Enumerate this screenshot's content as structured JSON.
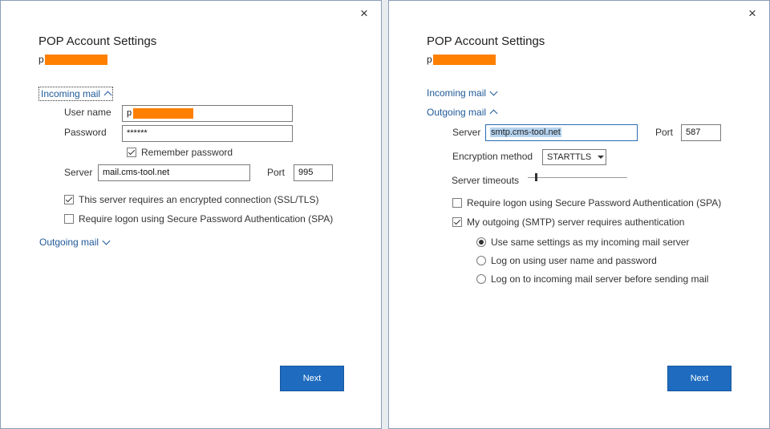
{
  "left": {
    "close_icon": "×",
    "title": "POP Account Settings",
    "account_prefix": "p",
    "incoming": {
      "label": "Incoming mail",
      "username_label": "User name",
      "username_prefix": "p",
      "password_label": "Password",
      "password_value": "******",
      "remember_label": "Remember password",
      "remember_checked": true,
      "server_label": "Server",
      "server_value": "mail.cms-tool.net",
      "port_label": "Port",
      "port_value": "995",
      "ssl_label": "This server requires an encrypted connection (SSL/TLS)",
      "ssl_checked": true,
      "spa_label": "Require logon using Secure Password Authentication (SPA)",
      "spa_checked": false
    },
    "outgoing_label": "Outgoing mail",
    "next_label": "Next"
  },
  "right": {
    "close_icon": "×",
    "title": "POP Account Settings",
    "account_prefix": "p",
    "incoming_label": "Incoming mail",
    "outgoing": {
      "label": "Outgoing mail",
      "server_label": "Server",
      "server_value": "smtp.cms-tool.net",
      "port_label": "Port",
      "port_value": "587",
      "encryption_label": "Encryption method",
      "encryption_value": "STARTTLS",
      "timeouts_label": "Server timeouts",
      "spa_label": "Require logon using Secure Password Authentication (SPA)",
      "spa_checked": false,
      "auth_label": "My outgoing (SMTP) server requires authentication",
      "auth_checked": true,
      "radio_same": "Use same settings as my incoming mail server",
      "radio_logon": "Log on using user name and password",
      "radio_before": "Log on to incoming mail server before sending mail",
      "selected_radio": "same"
    },
    "next_label": "Next"
  },
  "colors": {
    "accent": "#1e6bbf",
    "link": "#1f5897",
    "redaction": "#ff7f00"
  },
  "icons": {
    "close": "close-icon",
    "chevron_up": "chevron-up-icon",
    "chevron_down": "chevron-down-icon",
    "check": "check-icon"
  }
}
